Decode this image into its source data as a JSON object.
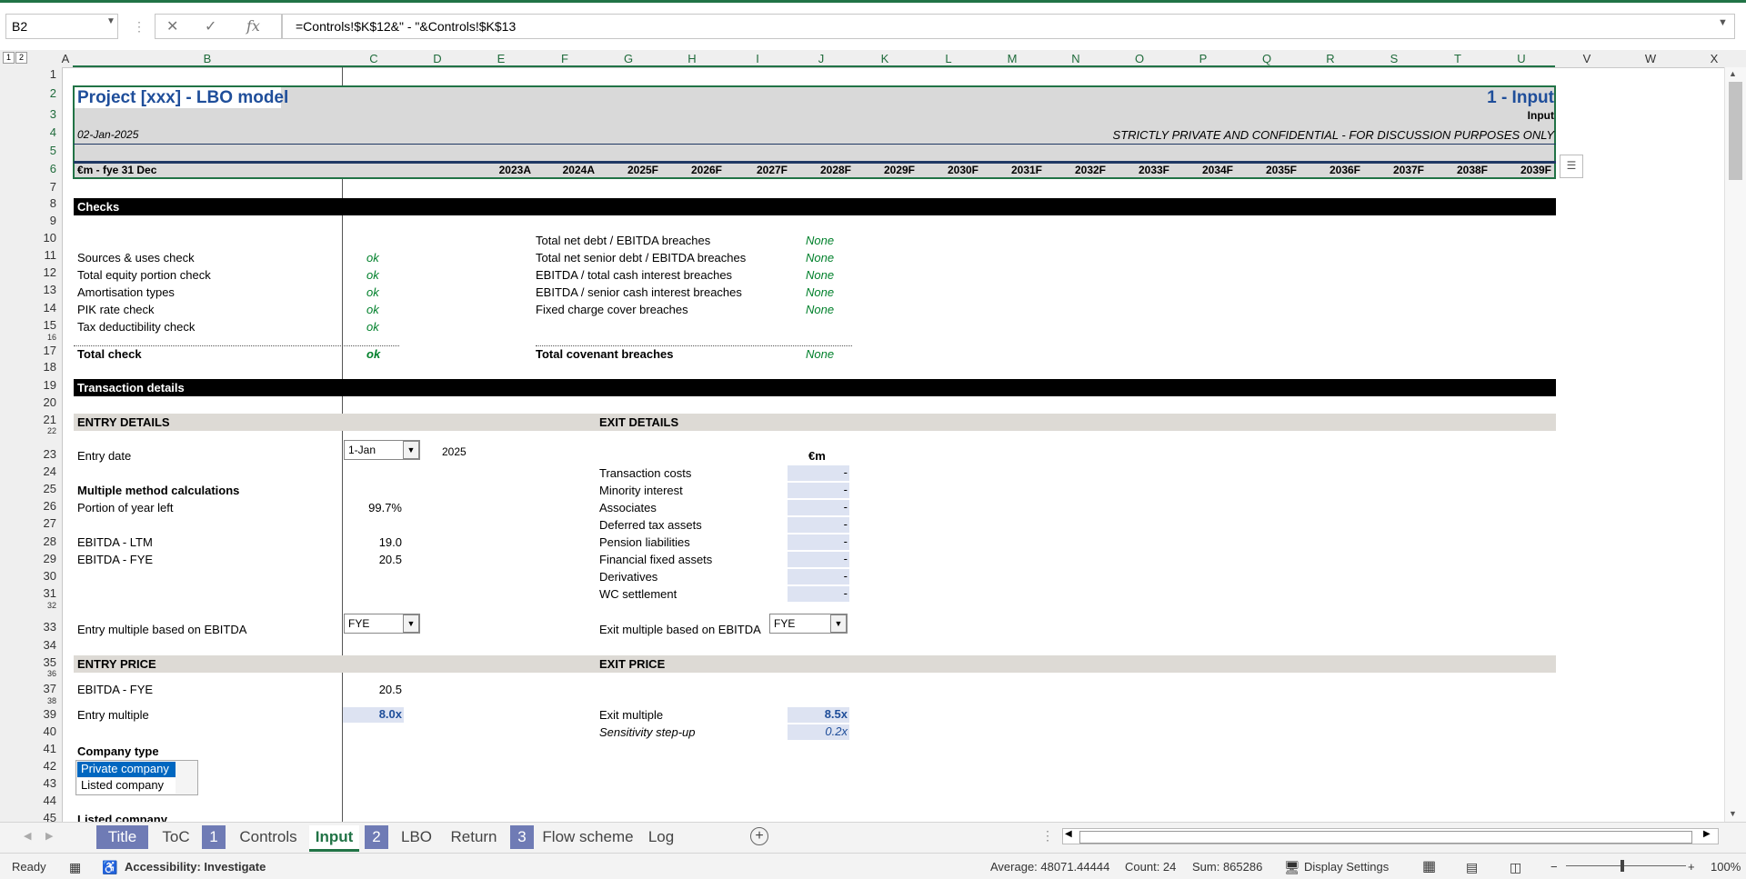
{
  "name_box": "B2",
  "formula_icons": {
    "cancel": "✕",
    "enter": "✓",
    "fx": "fx"
  },
  "formula": "=Controls!$K$12&\" - \"&Controls!$K$13",
  "outline_levels": [
    "1",
    "2"
  ],
  "columns": [
    "A",
    "B",
    "C",
    "D",
    "E",
    "F",
    "G",
    "H",
    "I",
    "J",
    "K",
    "L",
    "M",
    "N",
    "O",
    "P",
    "Q",
    "R",
    "S",
    "T",
    "U",
    "V",
    "W",
    "X"
  ],
  "rows": [
    "1",
    "2",
    "3",
    "4",
    "5",
    "6",
    "7",
    "8",
    "9",
    "10",
    "11",
    "12",
    "13",
    "14",
    "15",
    "16",
    "17",
    "18",
    "19",
    "20",
    "21",
    "22",
    "23",
    "24",
    "25",
    "26",
    "27",
    "28",
    "29",
    "30",
    "31",
    "32",
    "33",
    "34",
    "35",
    "36",
    "37",
    "38",
    "39",
    "40",
    "41",
    "42",
    "43",
    "44",
    "45"
  ],
  "header": {
    "title": "Project [xxx]  - LBO model",
    "page_title": "1 - Input",
    "page_sub": "Input",
    "date": "02-Jan-2025",
    "confidential": "STRICTLY PRIVATE AND CONFIDENTIAL - FOR DISCUSSION PURPOSES ONLY",
    "unit": "€m - fye 31 Dec",
    "years": [
      "2023A",
      "2024A",
      "2025F",
      "2026F",
      "2027F",
      "2028F",
      "2029F",
      "2030F",
      "2031F",
      "2032F",
      "2033F",
      "2034F",
      "2035F",
      "2036F",
      "2037F",
      "2038F",
      "2039F"
    ]
  },
  "checks": {
    "title": "Checks",
    "left": [
      {
        "label": "Sources & uses check",
        "value": "ok"
      },
      {
        "label": "Total equity portion check",
        "value": "ok"
      },
      {
        "label": "Amortisation types",
        "value": "ok"
      },
      {
        "label": "PIK rate check",
        "value": "ok"
      },
      {
        "label": "Tax deductibility check",
        "value": "ok"
      }
    ],
    "left_total": {
      "label": "Total check",
      "value": "ok"
    },
    "right": [
      {
        "label": "Total net debt / EBITDA breaches",
        "value": "None"
      },
      {
        "label": "Total net senior debt / EBITDA breaches",
        "value": "None"
      },
      {
        "label": "EBITDA / total cash interest breaches",
        "value": "None"
      },
      {
        "label": "EBITDA / senior cash interest breaches",
        "value": "None"
      },
      {
        "label": "Fixed charge cover breaches",
        "value": "None"
      }
    ],
    "right_total": {
      "label": "Total covenant breaches",
      "value": "None"
    }
  },
  "transaction": {
    "title": "Transaction details",
    "entry_header": "ENTRY DETAILS",
    "exit_header": "EXIT DETAILS",
    "entry_date_label": "Entry date",
    "entry_date_value": "1-Jan",
    "entry_year": "2025",
    "multiple_calc": "Multiple method calculations",
    "portion_label": "Portion of year left",
    "portion_value": "99.7%",
    "ebitda_ltm_label": "EBITDA - LTM",
    "ebitda_ltm_value": "19.0",
    "ebitda_fye_label": "EBITDA - FYE",
    "ebitda_fye_value": "20.5",
    "entry_multiple_basis_label": "Entry multiple based on EBITDA",
    "entry_multiple_basis_value": "FYE",
    "exit_unit": "€m",
    "exit_items": [
      {
        "label": "Transaction costs",
        "value": "-"
      },
      {
        "label": "Minority interest",
        "value": "-"
      },
      {
        "label": "Associates",
        "value": "-"
      },
      {
        "label": "Deferred tax assets",
        "value": "-"
      },
      {
        "label": "Pension liabilities",
        "value": "-"
      },
      {
        "label": "Financial fixed assets",
        "value": "-"
      },
      {
        "label": "Derivatives",
        "value": "-"
      },
      {
        "label": "WC settlement",
        "value": "-"
      }
    ],
    "exit_multiple_basis_label": "Exit multiple based on EBITDA",
    "exit_multiple_basis_value": "FYE",
    "entry_price_header": "ENTRY PRICE",
    "exit_price_header": "EXIT PRICE",
    "entry_price_ebitda_label": "EBITDA - FYE",
    "entry_price_ebitda_value": "20.5",
    "entry_multiple_label": "Entry multiple",
    "entry_multiple_value": "8.0x",
    "exit_multiple_label": "Exit multiple",
    "exit_multiple_value": "8.5x",
    "sensitivity_label": "Sensitivity step-up",
    "sensitivity_value": "0.2x",
    "company_type_label": "Company type",
    "company_type_options": [
      "Private company",
      "Listed company"
    ],
    "listed_company_label": "Listed company"
  },
  "sheet_tabs": [
    {
      "label": "Title",
      "kind": "num"
    },
    {
      "label": "ToC",
      "kind": "normal"
    },
    {
      "label": "1",
      "kind": "num"
    },
    {
      "label": "Controls",
      "kind": "normal"
    },
    {
      "label": "Input",
      "kind": "active"
    },
    {
      "label": "2",
      "kind": "num"
    },
    {
      "label": "LBO",
      "kind": "normal"
    },
    {
      "label": "Return",
      "kind": "normal"
    },
    {
      "label": "3",
      "kind": "num"
    },
    {
      "label": "Flow scheme",
      "kind": "normal"
    },
    {
      "label": "Log",
      "kind": "normal"
    }
  ],
  "add_sheet": "+",
  "status": {
    "ready": "Ready",
    "accessibility": "Accessibility: Investigate",
    "average": "Average: 48071.44444",
    "count": "Count: 24",
    "sum": "Sum: 865286",
    "display_settings": "Display Settings",
    "zoom": "100%"
  }
}
